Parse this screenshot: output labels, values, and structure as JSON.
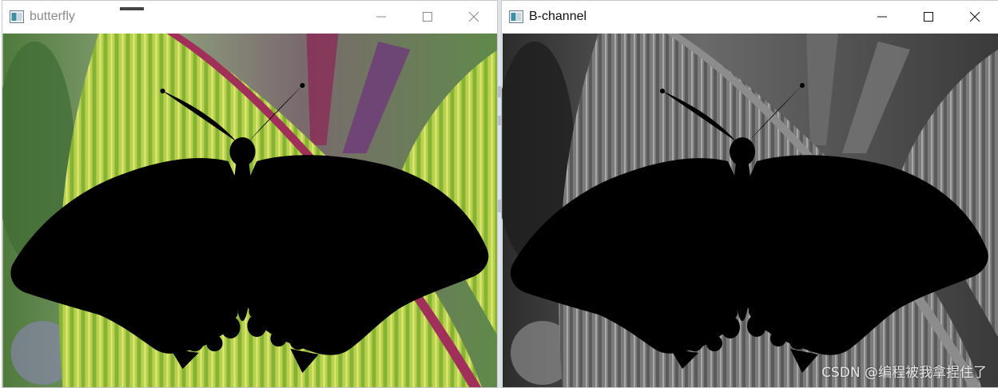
{
  "windows": [
    {
      "title": "butterfly",
      "icon": "opencv-window-icon",
      "controls": [
        "minimize",
        "maximize",
        "close"
      ],
      "image": "color photograph of a black-and-white swallowtail butterfly on a green striped leaf"
    },
    {
      "title": "B-channel",
      "icon": "opencv-window-icon",
      "controls": [
        "minimize",
        "maximize",
        "close"
      ],
      "image": "grayscale blue channel of the same butterfly photograph"
    }
  ],
  "watermark": "CSDN @编程被我拿捏住了",
  "colors": {
    "leaf_green": "#9cc43a",
    "leaf_yellow": "#d9e26a",
    "stem_magenta": "#a0305a",
    "wing_black": "#0d0d0d",
    "spot_white": "#f3f3ee",
    "eyespot_red": "#c8371b",
    "eyespot_blue": "#4a5f8a"
  }
}
